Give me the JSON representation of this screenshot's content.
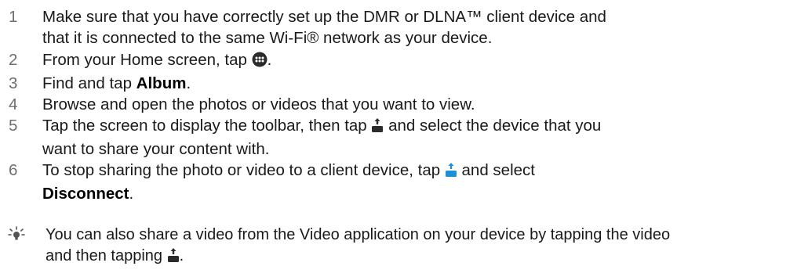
{
  "steps": [
    {
      "number": "1",
      "line1": "Make sure that you have correctly set up the DMR or DLNA™ client device and",
      "line2": "that it is connected to the same Wi-Fi® network as your device."
    },
    {
      "number": "2",
      "before": "From your Home screen, tap ",
      "icon": "apps-grid-icon",
      "after": "."
    },
    {
      "number": "3",
      "before": "Find and tap ",
      "bold": "Album",
      "after": "."
    },
    {
      "number": "4",
      "text": "Browse and open the photos or videos that you want to view."
    },
    {
      "number": "5",
      "before": "Tap the screen to display the toolbar, then tap ",
      "icon": "share-to-device-icon",
      "after": " and select the device that you",
      "line2": "want to share your content with."
    },
    {
      "number": "6",
      "before": "To stop sharing the photo or video to a client device, tap ",
      "icon": "sharing-active-icon",
      "after": " and select",
      "bold": "Disconnect",
      "bold_after": "."
    }
  ],
  "tip": {
    "icon": "lightbulb-tip-icon",
    "line1": "You can also share a video from the Video application on your device by tapping the video",
    "line2_before": "and then tapping ",
    "line2_icon": "share-to-device-icon",
    "line2_after": "."
  },
  "colors": {
    "step_number": "#6f6f6f",
    "text": "#1a1a1a",
    "icon_dark": "#2b2b2b",
    "icon_active": "#1f8fd6",
    "tip_icon": "#555555"
  }
}
